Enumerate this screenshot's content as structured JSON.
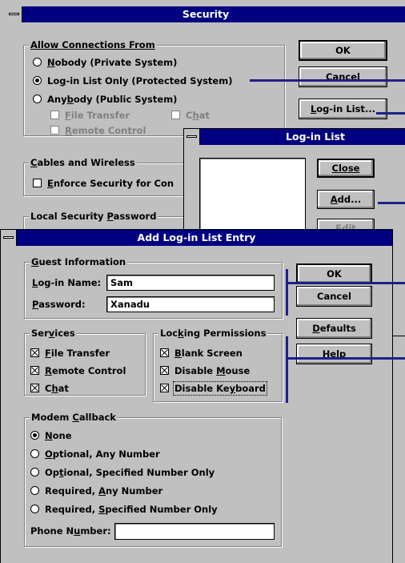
{
  "security": {
    "title": "Security",
    "allow_group": "Allow Connections From",
    "options": [
      {
        "pre": "",
        "key": "N",
        "post": "obody (Private System)"
      },
      {
        "pre": "Lo",
        "key": "g",
        "post": "-in List Only (Protected System)"
      },
      {
        "pre": "Any",
        "key": "b",
        "post": "ody (Public System)"
      }
    ],
    "sub_services": [
      {
        "pre": "",
        "key": "F",
        "post": "ile Transfer"
      },
      {
        "pre": "C",
        "key": "h",
        "post": "at"
      },
      {
        "pre": "",
        "key": "R",
        "post": "emote Control"
      }
    ],
    "ok": "OK",
    "cancel": "Cancel",
    "login_list_btn": {
      "pre": "",
      "key": "L",
      "post": "og-in List..."
    },
    "cables_group": {
      "pre": "",
      "key": "C",
      "post": "ables and Wireless"
    },
    "enforce": {
      "pre": "",
      "key": "E",
      "post": "nforce Security for Con"
    },
    "local_pw_group": {
      "pre": "Local Security ",
      "key": "P",
      "post": "assword"
    }
  },
  "login_list": {
    "title": "Log-in List",
    "close": "Close",
    "add": {
      "pre": "",
      "key": "A",
      "post": "dd..."
    },
    "edit": "Edit"
  },
  "add_entry": {
    "title": "Add Log-in List Entry",
    "guest_group": {
      "pre": "",
      "key": "G",
      "post": "uest Information"
    },
    "login_label": {
      "pre": "",
      "key": "L",
      "post": "og-in Name:"
    },
    "login_value": "Sam",
    "password_label": {
      "pre": "",
      "key": "P",
      "post": "assword:"
    },
    "password_value": "Xanadu",
    "ok": "OK",
    "cancel": "Cancel",
    "defaults": {
      "pre": "",
      "key": "D",
      "post": "efaults"
    },
    "help": "Help",
    "services_group": {
      "pre": "Ser",
      "key": "v",
      "post": "ices"
    },
    "services": [
      {
        "pre": "",
        "key": "F",
        "post": "ile Transfer"
      },
      {
        "pre": "",
        "key": "R",
        "post": "emote Control"
      },
      {
        "pre": "C",
        "key": "h",
        "post": "at"
      }
    ],
    "locking_group": {
      "pre": "Loc",
      "key": "k",
      "post": "ing Permissions"
    },
    "locking": [
      {
        "pre": "",
        "key": "B",
        "post": "lank Screen"
      },
      {
        "pre": "Disable ",
        "key": "M",
        "post": "ouse"
      },
      {
        "pre": "Disable Ke",
        "key": "y",
        "post": "board"
      }
    ],
    "modem_group": {
      "pre": "Modem ",
      "key": "C",
      "post": "allback"
    },
    "modem_options": [
      {
        "pre": "",
        "key": "N",
        "post": "one"
      },
      {
        "pre": "",
        "key": "O",
        "post": "ptional, Any Number"
      },
      {
        "pre": "Op",
        "key": "t",
        "post": "ional, Specified Number Only"
      },
      {
        "pre": "Required, ",
        "key": "A",
        "post": "ny Number"
      },
      {
        "pre": "Required, ",
        "key": "S",
        "post": "pecified Number Only"
      }
    ],
    "phone_label": {
      "pre": "Phone N",
      "key": "u",
      "post": "mber:"
    },
    "phone_value": ""
  },
  "colors": {
    "title_bar": "#000080",
    "dialog": "#c0c0c0",
    "callout": "#1f1f8a"
  }
}
